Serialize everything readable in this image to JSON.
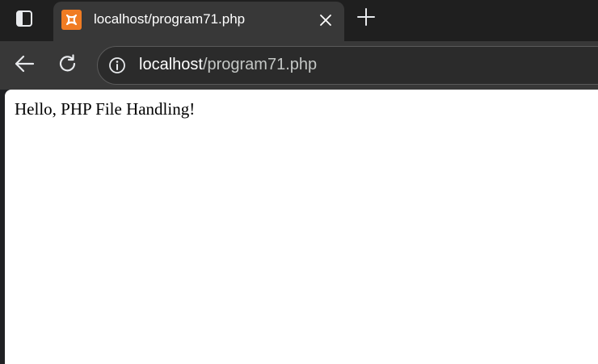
{
  "browser": {
    "tab": {
      "title": "localhost/program71.php",
      "favicon": "xampp-icon"
    },
    "address_bar": {
      "host": "localhost",
      "path": "/program71.php"
    },
    "icons": {
      "sidebar": "sidebar-icon",
      "close": "close-icon",
      "new_tab": "plus-icon",
      "back": "back-arrow-icon",
      "reload": "reload-icon",
      "site_info": "info-icon"
    },
    "colors": {
      "favicon": "#f07c23",
      "tab_active": "#383838",
      "tabstrip": "#1f1f1f"
    }
  },
  "page": {
    "content": "Hello, PHP File Handling!"
  }
}
